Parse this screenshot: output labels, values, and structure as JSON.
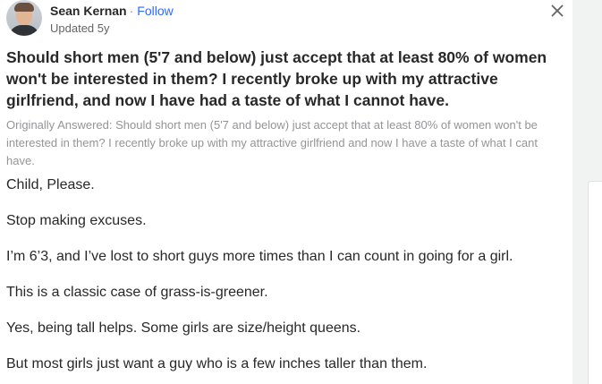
{
  "author": {
    "name": "Sean Kernan",
    "separator": "·",
    "follow_label": "Follow",
    "updated": "Updated 5y"
  },
  "close_symbol": "×",
  "question": "Should short men (5'7 and below) just accept that at least 80% of women won't be interested in them? I recently broke up with my attractive girlfriend, and now I have had a taste of what I cannot have.",
  "originally_answered": "Originally Answered: Should short men (5'7 and below) just accept that at least 80% of women won't be interested in them? I recently broke up with my attractive girlfriend and now I have a taste of what I cant have.",
  "answer": {
    "paragraphs": [
      "Child, Please.",
      "Stop making excuses.",
      "I’m 6’3, and I’ve lost to short guys more times than I can count in going for a girl.",
      "This is a classic case of grass-is-greener.",
      "Yes, being tall helps. Some girls are size/height queens.",
      "But most girls just want a guy who is a few inches taller than them."
    ]
  },
  "colors": {
    "text": "#282829",
    "secondary_text": "#636466",
    "muted_text": "#939598",
    "link": "#2e69ff",
    "gutter": "#f1f2f2"
  },
  "icons": {
    "avatar": "author-avatar-photo",
    "close": "close-icon"
  }
}
